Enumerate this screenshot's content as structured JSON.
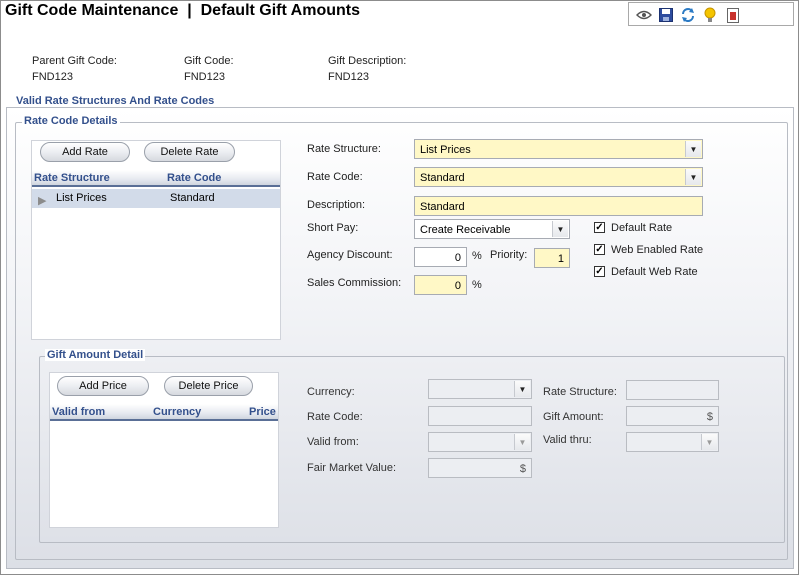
{
  "page": {
    "title": "Gift Code Maintenance  |  Default Gift Amounts"
  },
  "toolbar": {
    "icons": [
      "view-icon",
      "save-icon",
      "refresh-icon",
      "tip-icon",
      "report-icon"
    ]
  },
  "header": {
    "parent_gift_code_label": "Parent Gift Code:",
    "parent_gift_code_value": "FND123",
    "gift_code_label": "Gift Code:",
    "gift_code_value": "FND123",
    "gift_description_label": "Gift Description:",
    "gift_description_value": "FND123"
  },
  "valid_rates": {
    "title": "Valid Rate Structures And Rate Codes"
  },
  "rate_code_details": {
    "title": "Rate Code Details",
    "add_rate": "Add Rate",
    "delete_rate": "Delete Rate",
    "columns": [
      "Rate Structure",
      "Rate Code"
    ],
    "rows": [
      {
        "rate_structure": "List Prices",
        "rate_code": "Standard"
      }
    ],
    "form": {
      "rate_structure_label": "Rate Structure:",
      "rate_structure_value": "List Prices",
      "rate_code_label": "Rate Code:",
      "rate_code_value": "Standard",
      "description_label": "Description:",
      "description_value": "Standard",
      "short_pay_label": "Short Pay:",
      "short_pay_value": "Create Receivable",
      "agency_discount_label": "Agency Discount:",
      "agency_discount_value": "0",
      "percent_symbol": "%",
      "priority_label": "Priority:",
      "priority_value": "1",
      "sales_commission_label": "Sales Commission:",
      "sales_commission_value": "0",
      "default_rate_label": "Default Rate",
      "default_rate_checked": true,
      "web_enabled_rate_label": "Web Enabled Rate",
      "web_enabled_rate_checked": true,
      "default_web_rate_label": "Default Web Rate",
      "default_web_rate_checked": true
    }
  },
  "gift_amount_detail": {
    "title": "Gift Amount Detail",
    "add_price": "Add Price",
    "delete_price": "Delete Price",
    "columns": [
      "Valid from",
      "Currency",
      "Price"
    ],
    "form": {
      "currency_label": "Currency:",
      "currency_value": "",
      "rate_structure_label": "Rate Structure:",
      "rate_structure_value": "",
      "rate_code_label": "Rate Code:",
      "rate_code_value": "",
      "gift_amount_label": "Gift Amount:",
      "gift_amount_value": "$",
      "valid_from_label": "Valid from:",
      "valid_from_value": "",
      "valid_thru_label": "Valid thru:",
      "valid_thru_value": "",
      "fair_market_value_label": "Fair Market Value:",
      "fair_market_value_value": "$"
    }
  },
  "colors": {
    "section_title": "#33508c",
    "required_field": "#fff8c6",
    "selected_row": "#d2dbe9"
  }
}
